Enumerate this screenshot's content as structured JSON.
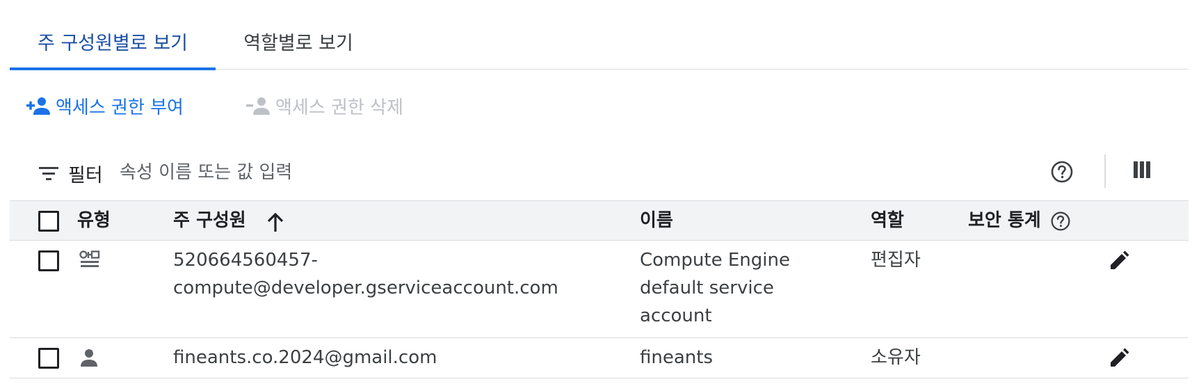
{
  "tabs": [
    {
      "label": "주 구성원별로 보기",
      "active": true
    },
    {
      "label": "역할별로 보기",
      "active": false
    }
  ],
  "actions": {
    "grant": "액세스 권한 부여",
    "revoke": "액세스 권한 삭제"
  },
  "filter": {
    "label": "필터",
    "placeholder": "속성 이름 또는 값 입력"
  },
  "table": {
    "headers": {
      "type": "유형",
      "principal": "주 구성원",
      "name": "이름",
      "role": "역할",
      "security": "보안 통계"
    },
    "rows": [
      {
        "type_icon": "service-account-icon",
        "principal_line1": "520664560457-",
        "principal_line2": "compute@developer.gserviceaccount.com",
        "name_line1": "Compute Engine",
        "name_line2": "default service",
        "name_line3": "account",
        "role": "편집자"
      },
      {
        "type_icon": "person-icon",
        "principal_line1": "fineants.co.2024@gmail.com",
        "name_line1": "fineants",
        "role": "소유자"
      }
    ]
  },
  "colors": {
    "accent": "#1a73e8",
    "active_tab_text": "#1a4fa3",
    "disabled": "#bdc1c6",
    "header_bg": "#f1f3f4",
    "border": "#dadce0"
  }
}
